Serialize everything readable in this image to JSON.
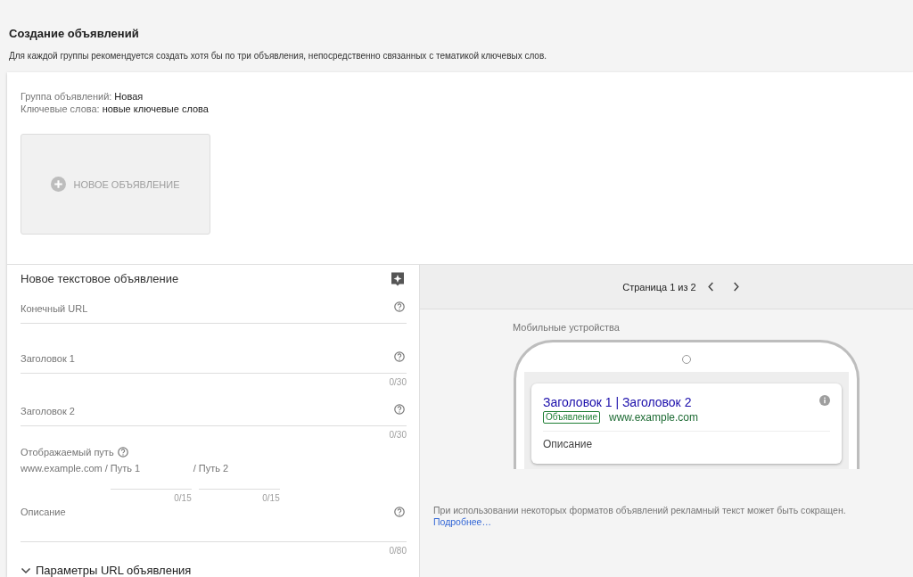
{
  "heading": "Создание объявлений",
  "description": "Для каждой группы рекомендуется создать хотя бы по три объявления, непосредственно связанных с тематикой ключевых слов.",
  "summary": [
    {
      "label": "Группа объявлений:",
      "value": "Новая"
    },
    {
      "label": "Ключевые слова:",
      "value": "новые ключевые слова"
    }
  ],
  "new_ad_button": {
    "label": "НОВОЕ ОБЪЯВЛЕНИЕ",
    "disabled": true
  },
  "editor": {
    "title": "Новое текстовое объявление",
    "fields": [
      {
        "kind": "text",
        "placeholder": "Конечный URL"
      },
      {
        "kind": "text",
        "placeholder": "Заголовок 1",
        "counter": "0/30"
      },
      {
        "kind": "text",
        "placeholder": "Заголовок 2",
        "counter": "0/30"
      },
      {
        "kind": "path",
        "label": "Отображаемый путь",
        "domain": "www.example.com",
        "paths": [
          {
            "separator": "/",
            "placeholder": "Путь 1",
            "counter": "0/15"
          },
          {
            "separator": "/",
            "placeholder": "Путь 2",
            "counter": "0/15"
          }
        ]
      },
      {
        "kind": "textarea",
        "placeholder": "Описание",
        "counter": "0/80"
      }
    ],
    "url_options": {
      "label": "Параметры URL объявления",
      "expanded": false
    }
  },
  "preview": {
    "pager": "Страница 1 из 2",
    "device_label": "Мобильные устройства",
    "ad": {
      "headline": "Заголовок 1 | Заголовок 2",
      "badge": "Объявление",
      "url": "www.example.com",
      "description": "Описание"
    },
    "note": "При использовании некоторых форматов объявлений рекламный текст может быть сокращен.",
    "link": "Подробнее…"
  }
}
